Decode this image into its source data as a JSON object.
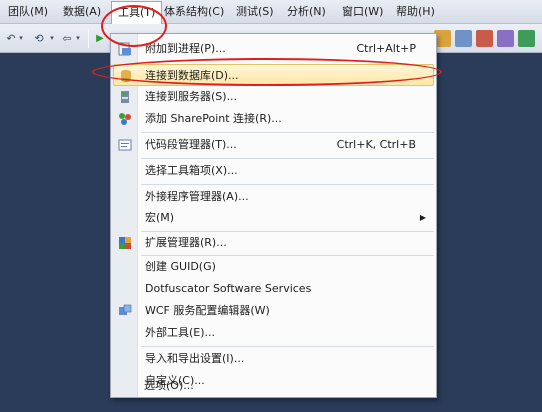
{
  "menubar": {
    "items": [
      {
        "label": "团队(M)"
      },
      {
        "label": "数据(A)"
      },
      {
        "label": "工具(T)"
      },
      {
        "label": "体系结构(C)"
      },
      {
        "label": "测试(S)"
      },
      {
        "label": "分析(N)"
      },
      {
        "label": "窗口(W)"
      },
      {
        "label": "帮助(H)"
      }
    ],
    "active_item": "工具(T)"
  },
  "toolbar": {
    "icons": [
      "undo-icon",
      "redo-icon",
      "start-debug-icon",
      "server-explorer-icon",
      "properties-icon",
      "toolbox-icon",
      "object-browser-icon"
    ]
  },
  "tools_menu": {
    "items": [
      {
        "label": "附加到进程(P)...",
        "shortcut": "Ctrl+Alt+P",
        "icon": "attach-process-icon"
      },
      {
        "label": "连接到数据库(D)...",
        "shortcut": "",
        "icon": "connect-database-icon",
        "highlighted": true
      },
      {
        "label": "连接到服务器(S)...",
        "shortcut": "",
        "icon": "connect-server-icon"
      },
      {
        "label": "添加 SharePoint 连接(R)...",
        "shortcut": "",
        "icon": "sharepoint-icon"
      },
      {
        "label": "代码段管理器(T)...",
        "shortcut": "Ctrl+K, Ctrl+B",
        "icon": "snippet-manager-icon"
      },
      {
        "label": "选择工具箱项(X)...",
        "shortcut": "",
        "icon": ""
      },
      {
        "label": "外接程序管理器(A)...",
        "shortcut": "",
        "icon": ""
      },
      {
        "label": "宏(M)",
        "shortcut": "",
        "icon": "",
        "submenu": true
      },
      {
        "label": "扩展管理器(R)...",
        "shortcut": "",
        "icon": "extension-manager-icon"
      },
      {
        "label": "创建 GUID(G)",
        "shortcut": "",
        "icon": ""
      },
      {
        "label": "Dotfuscator Software Services",
        "shortcut": "",
        "icon": ""
      },
      {
        "label": "WCF 服务配置编辑器(W)",
        "shortcut": "",
        "icon": "wcf-config-icon"
      },
      {
        "label": "外部工具(E)...",
        "shortcut": "",
        "icon": ""
      },
      {
        "label": "导入和导出设置(I)...",
        "shortcut": "",
        "icon": ""
      },
      {
        "label": "自定义(C)...",
        "shortcut": "",
        "icon": ""
      },
      {
        "label": "选项(O)...",
        "shortcut": "",
        "icon": ""
      }
    ]
  },
  "colors": {
    "background": "#2b3c59",
    "highlight": "#ffe8a6",
    "annotation": "#e11e1e"
  }
}
